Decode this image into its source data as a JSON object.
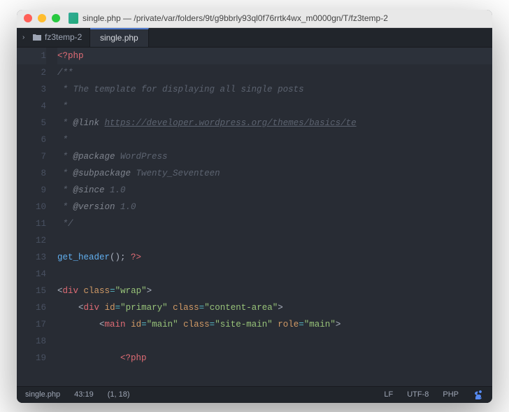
{
  "window": {
    "title": "single.php — /private/var/folders/9t/g9bbrly93ql0f76rrtk4wx_m0000gn/T/fz3temp-2"
  },
  "project": {
    "root": "fz3temp-2"
  },
  "tab": {
    "label": "single.php"
  },
  "lines": {
    "n1": "1",
    "n2": "2",
    "n3": "3",
    "n4": "4",
    "n5": "5",
    "n6": "6",
    "n7": "7",
    "n8": "8",
    "n9": "9",
    "n10": "10",
    "n11": "11",
    "n12": "12",
    "n13": "13",
    "n14": "14",
    "n15": "15",
    "n16": "16",
    "n17": "17",
    "n18": "18",
    "n19": "19"
  },
  "code": {
    "l1_open": "<?php",
    "l2": "/**",
    "l3_star": " * ",
    "l3_text": "The template for displaying all single posts",
    "l4": " *",
    "l5_star": " * ",
    "l5_tag": "@link",
    "l5_sp": " ",
    "l5_url": "https://developer.wordpress.org/themes/basics/te",
    "l6": " *",
    "l7_star": " * ",
    "l7_tag": "@package",
    "l7_sp": " ",
    "l7_val": "WordPress",
    "l8_star": " * ",
    "l8_tag": "@subpackage",
    "l8_sp": " ",
    "l8_val": "Twenty_Seventeen",
    "l9_star": " * ",
    "l9_tag": "@since",
    "l9_sp": " ",
    "l9_val": "1.0",
    "l10_star": " * ",
    "l10_tag": "@version",
    "l10_sp": " ",
    "l10_val": "1.0",
    "l11": " */",
    "l13_fn": "get_header",
    "l13_paren": "();",
    "l13_sp": " ",
    "l13_close": "?>",
    "l15_open": "<",
    "l15_tag": "div",
    "l15_sp": " ",
    "l15_attr": "class",
    "l15_eq": "=",
    "l15_q1": "\"",
    "l15_val": "wrap",
    "l15_q2": "\"",
    "l15_close": ">",
    "l16_pad": "    ",
    "l16_open": "<",
    "l16_tag": "div",
    "l16_sp": " ",
    "l16_attr1": "id",
    "l16_eq1": "=",
    "l16_q1": "\"",
    "l16_val1": "primary",
    "l16_q2": "\"",
    "l16_sp2": " ",
    "l16_attr2": "class",
    "l16_eq2": "=",
    "l16_q3": "\"",
    "l16_val2": "content-area",
    "l16_q4": "\"",
    "l16_close": ">",
    "l17_pad": "        ",
    "l17_open": "<",
    "l17_tag": "main",
    "l17_sp": " ",
    "l17_attr1": "id",
    "l17_eq1": "=",
    "l17_q1": "\"",
    "l17_val1": "main",
    "l17_q2": "\"",
    "l17_sp2": " ",
    "l17_attr2": "class",
    "l17_eq2": "=",
    "l17_q3": "\"",
    "l17_val2": "site-main",
    "l17_q4": "\"",
    "l17_sp3": " ",
    "l17_attr3": "role",
    "l17_eq3": "=",
    "l17_q5": "\"",
    "l17_val3": "main",
    "l17_q6": "\"",
    "l17_close": ">",
    "l19_pad": "            ",
    "l19_open": "<?php"
  },
  "status": {
    "file": "single.php",
    "size": "43:19",
    "cursor": "(1, 18)",
    "eol": "LF",
    "encoding": "UTF-8",
    "lang": "PHP"
  }
}
